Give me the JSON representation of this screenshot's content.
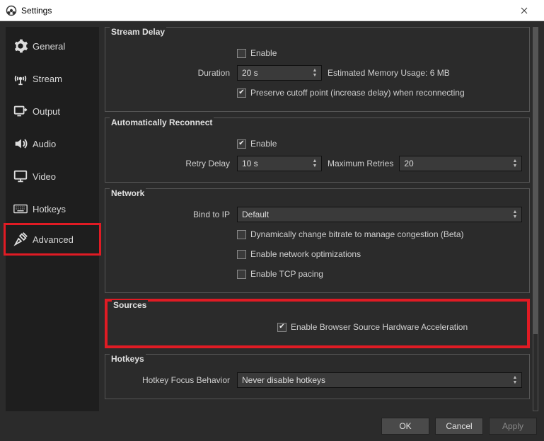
{
  "window": {
    "title": "Settings"
  },
  "sidebar": {
    "items": [
      {
        "label": "General"
      },
      {
        "label": "Stream"
      },
      {
        "label": "Output"
      },
      {
        "label": "Audio"
      },
      {
        "label": "Video"
      },
      {
        "label": "Hotkeys"
      },
      {
        "label": "Advanced"
      }
    ]
  },
  "groups": {
    "streamDelay": {
      "title": "Stream Delay",
      "enable_label": "Enable",
      "duration_label": "Duration",
      "duration_value": "20 s",
      "memory_label": "Estimated Memory Usage: 6 MB",
      "preserve_label": "Preserve cutoff point (increase delay) when reconnecting"
    },
    "autoReconnect": {
      "title": "Automatically Reconnect",
      "enable_label": "Enable",
      "retry_delay_label": "Retry Delay",
      "retry_delay_value": "10 s",
      "max_retries_label": "Maximum Retries",
      "max_retries_value": "20"
    },
    "network": {
      "title": "Network",
      "bind_label": "Bind to IP",
      "bind_value": "Default",
      "dyn_bitrate_label": "Dynamically change bitrate to manage congestion (Beta)",
      "net_opt_label": "Enable network optimizations",
      "tcp_pacing_label": "Enable TCP pacing"
    },
    "sources": {
      "title": "Sources",
      "hw_accel_label": "Enable Browser Source Hardware Acceleration"
    },
    "hotkeys": {
      "title": "Hotkeys",
      "focus_label": "Hotkey Focus Behavior",
      "focus_value": "Never disable hotkeys"
    }
  },
  "footer": {
    "ok": "OK",
    "cancel": "Cancel",
    "apply": "Apply"
  }
}
